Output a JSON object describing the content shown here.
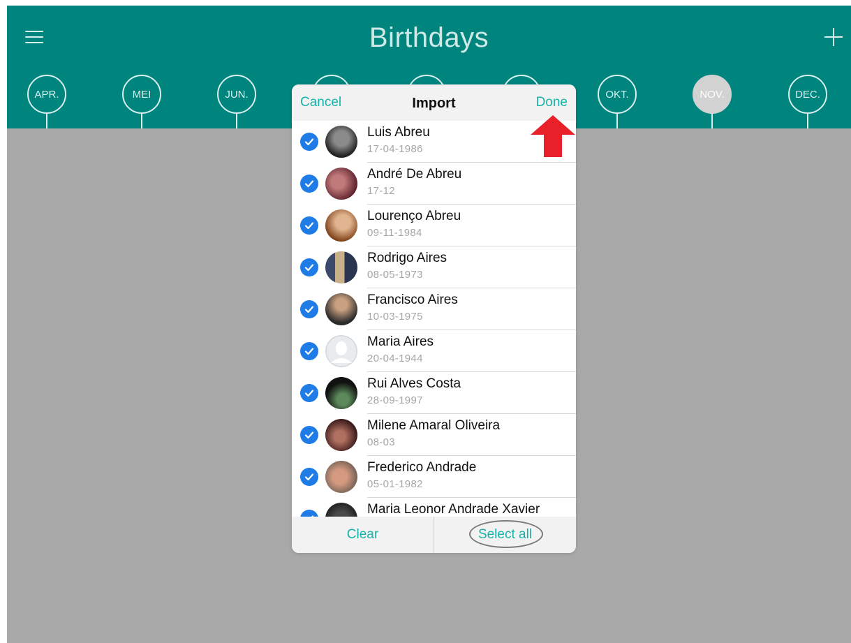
{
  "header": {
    "title": "Birthdays"
  },
  "months": [
    {
      "label": "APR.",
      "active": false
    },
    {
      "label": "MEI",
      "active": false
    },
    {
      "label": "JUN.",
      "active": false
    },
    {
      "label": "",
      "active": false
    },
    {
      "label": "",
      "active": false
    },
    {
      "label": "",
      "active": false
    },
    {
      "label": "OKT.",
      "active": false
    },
    {
      "label": "NOV.",
      "active": true
    },
    {
      "label": "DEC.",
      "active": false
    }
  ],
  "dialog": {
    "cancel_label": "Cancel",
    "title": "Import",
    "done_label": "Done",
    "clear_label": "Clear",
    "select_all_label": "Select all"
  },
  "contacts": [
    {
      "name": "Luis Abreu",
      "date": "17-04-1986",
      "checked": true,
      "avatar": "photo"
    },
    {
      "name": "André De Abreu",
      "date": "17-12",
      "checked": true,
      "avatar": "photo"
    },
    {
      "name": "Lourenço Abreu",
      "date": "09-11-1984",
      "checked": true,
      "avatar": "photo"
    },
    {
      "name": "Rodrigo Aires",
      "date": "08-05-1973",
      "checked": true,
      "avatar": "photo"
    },
    {
      "name": "Francisco Aires",
      "date": "10-03-1975",
      "checked": true,
      "avatar": "photo"
    },
    {
      "name": "Maria Aires",
      "date": "20-04-1944",
      "checked": true,
      "avatar": "placeholder"
    },
    {
      "name": "Rui Alves Costa",
      "date": "28-09-1997",
      "checked": true,
      "avatar": "photo"
    },
    {
      "name": "Milene Amaral Oliveira",
      "date": "08-03",
      "checked": true,
      "avatar": "photo"
    },
    {
      "name": "Frederico Andrade",
      "date": "05-01-1982",
      "checked": true,
      "avatar": "photo"
    },
    {
      "name": "Maria Leonor Andrade Xavier",
      "date": "",
      "checked": true,
      "avatar": "photo"
    }
  ],
  "colors": {
    "header": "#00857e",
    "accent": "#17b3a9",
    "check": "#1f7be6",
    "overlay": "#a9a9a9",
    "annotation_arrow": "#e8202a"
  }
}
